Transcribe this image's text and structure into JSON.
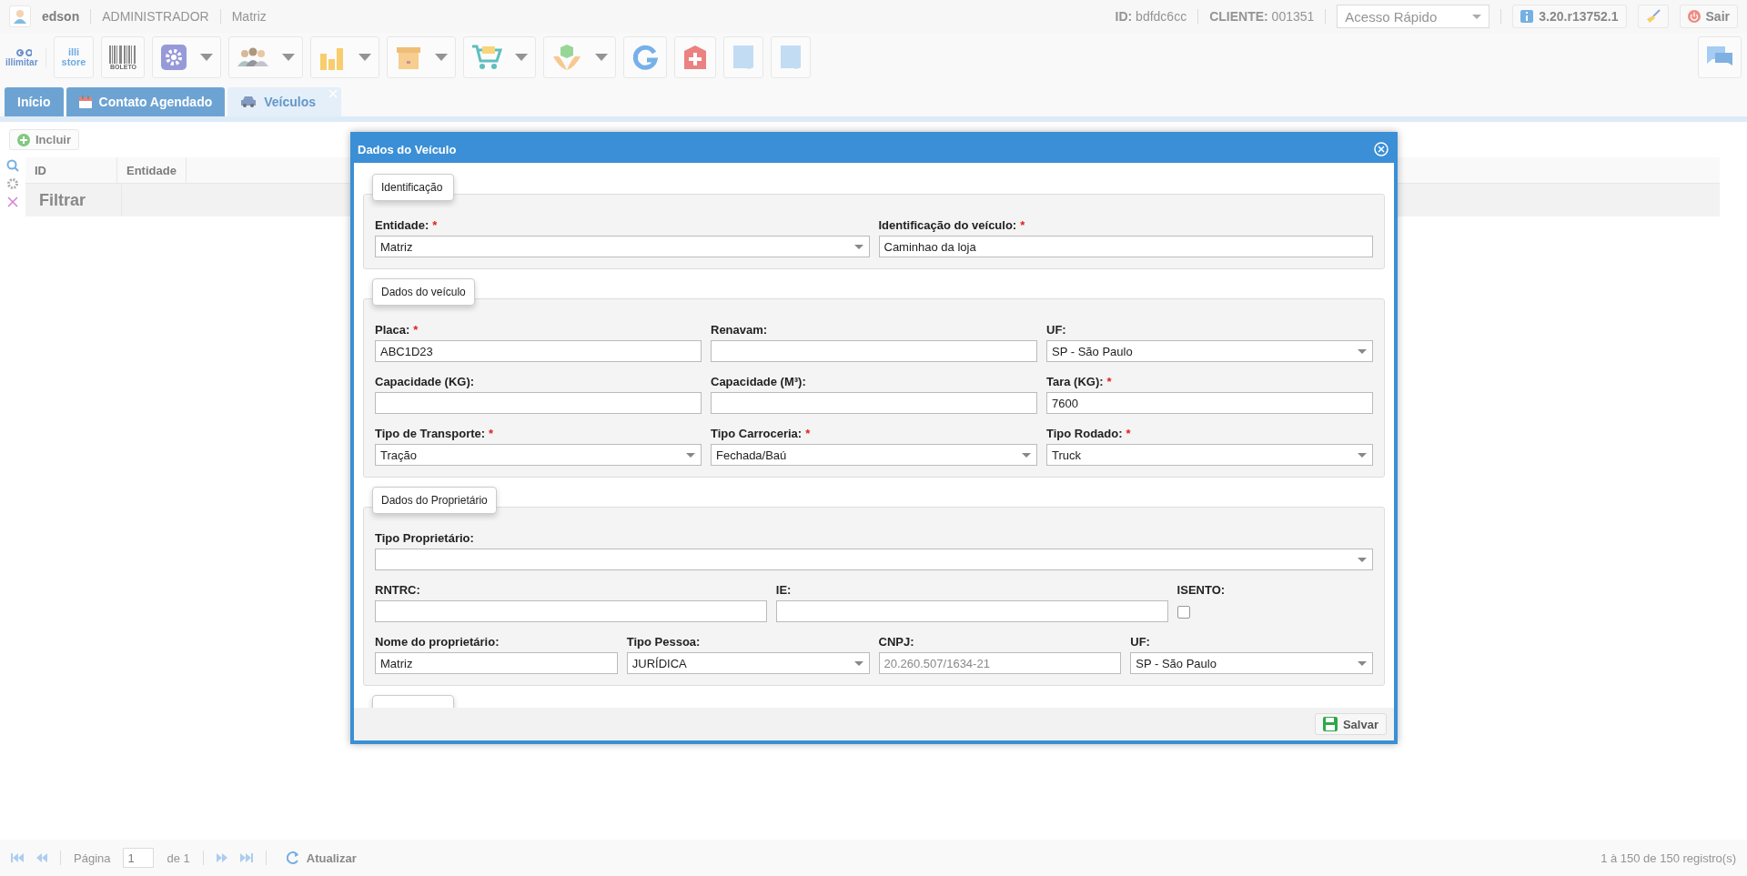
{
  "header": {
    "user": "edson",
    "role": "ADMINISTRADOR",
    "company": "Matriz",
    "id_label": "ID:",
    "id_value": "bdfdc6cc",
    "client_label": "CLIENTE:",
    "client_value": "001351",
    "quick_access": {
      "placeholder": "Acesso Rápido"
    },
    "version": "3.20.r13752.1",
    "logout": "Sair"
  },
  "toolbar": {
    "logo": "illimitar",
    "items": [
      {
        "kind": "store",
        "dropdown": false,
        "text_lines": [
          "illi",
          "store"
        ]
      },
      {
        "kind": "barcode",
        "dropdown": false,
        "text_lines": [
          "BOLETO"
        ]
      },
      {
        "kind": "gear",
        "dropdown": true
      },
      {
        "kind": "people",
        "dropdown": true
      },
      {
        "kind": "chart",
        "dropdown": true
      },
      {
        "kind": "box",
        "dropdown": true
      },
      {
        "kind": "cart",
        "dropdown": true
      },
      {
        "kind": "hands",
        "dropdown": true
      },
      {
        "kind": "refresh",
        "dropdown": false
      },
      {
        "kind": "medical",
        "dropdown": false
      },
      {
        "kind": "document",
        "dropdown": false
      },
      {
        "kind": "document",
        "dropdown": false
      }
    ]
  },
  "tabs": [
    {
      "label": "Início",
      "kind": "plain",
      "selected": false,
      "closable": false
    },
    {
      "label": "Contato Agendado",
      "kind": "calendar",
      "selected": false,
      "closable": false
    },
    {
      "label": "Veículos",
      "kind": "car",
      "selected": true,
      "closable": true
    }
  ],
  "grid": {
    "add_button": "Incluir",
    "columns": [
      "ID",
      "Entidade"
    ],
    "filter_label": "Filtrar"
  },
  "pager": {
    "page_label": "Página",
    "page": "1",
    "of": "de 1",
    "refresh": "Atualizar",
    "summary": "1 à 150 de 150 registro(s)"
  },
  "modal": {
    "title": "Dados do Veículo",
    "sections": [
      {
        "legend": "Identificação",
        "lines": [
          {
            "fields": [
              {
                "label": "Entidade:",
                "required_mark": "*",
                "kind": "select",
                "value": "Matriz"
              },
              {
                "label": "Identificação do veículo:",
                "required_mark": "*",
                "kind": "text",
                "value": "Caminhao da loja"
              }
            ]
          }
        ]
      },
      {
        "legend": "Dados do veículo",
        "lines": [
          {
            "fields": [
              {
                "label": "Placa:",
                "required_mark": "*",
                "kind": "text",
                "value": "ABC1D23"
              },
              {
                "label": "Renavam:",
                "kind": "text"
              },
              {
                "label": "UF:",
                "kind": "select",
                "value": "SP - São Paulo"
              }
            ]
          },
          {
            "fields": [
              {
                "label": "Capacidade (KG):",
                "kind": "text"
              },
              {
                "label": "Capacidade (M³):",
                "kind": "text"
              },
              {
                "label": "Tara (KG):",
                "required_mark": "*",
                "kind": "text",
                "value": "7600"
              }
            ]
          },
          {
            "fields": [
              {
                "label": "Tipo de Transporte:",
                "required_mark": "*",
                "kind": "select",
                "value": "Tração"
              },
              {
                "label": "Tipo Carroceria:",
                "required_mark": "*",
                "kind": "select",
                "value": "Fechada/Baú"
              },
              {
                "label": "Tipo Rodado:",
                "required_mark": "*",
                "kind": "select",
                "value": "Truck"
              }
            ]
          }
        ]
      },
      {
        "legend": "Dados do Proprietário",
        "lines": [
          {
            "fields": [
              {
                "label": "Tipo Proprietário:",
                "kind": "select"
              }
            ]
          },
          {
            "fields": [
              {
                "label": "RNTRC:",
                "kind": "text"
              },
              {
                "label": "IE:",
                "kind": "text"
              },
              {
                "label": "ISENTO:",
                "kind": "checkbox",
                "checked": false
              }
            ]
          },
          {
            "fields": [
              {
                "label": "Nome do proprietário:",
                "kind": "text",
                "value": "Matriz"
              },
              {
                "label": "Tipo Pessoa:",
                "kind": "select",
                "value": "JURÍDICA"
              },
              {
                "label": "CNPJ:",
                "kind": "text",
                "value": "20.260.507/1634-21",
                "readonly": true
              },
              {
                "label": "UF:",
                "kind": "select",
                "value": "SP - São Paulo"
              }
            ]
          }
        ]
      }
    ],
    "save_button": "Salvar"
  }
}
